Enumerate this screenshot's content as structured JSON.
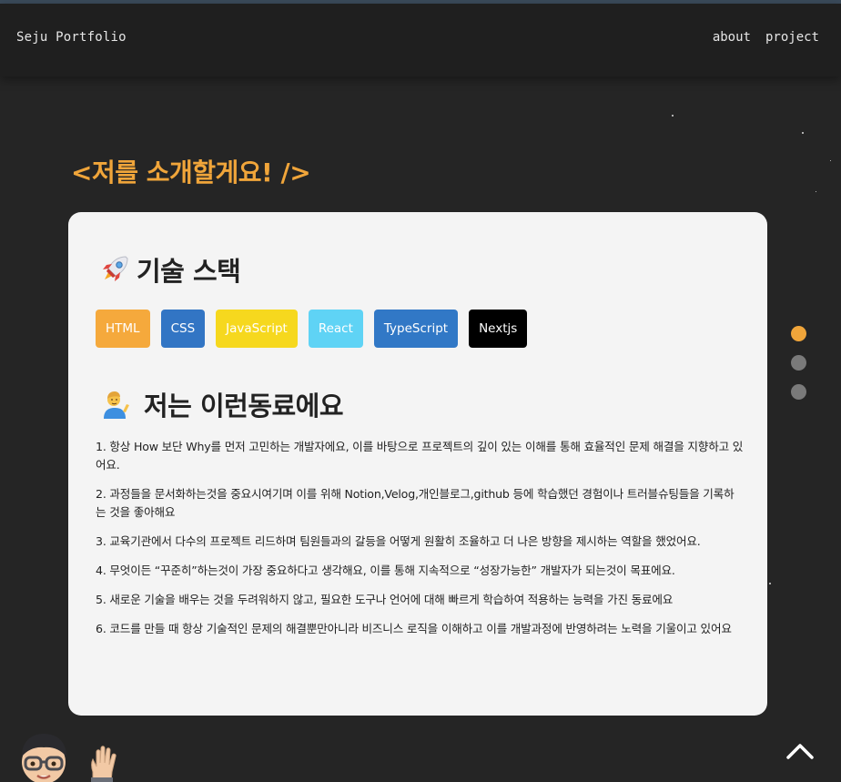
{
  "navbar": {
    "brand": "Seju Portfolio",
    "links": [
      {
        "label": "about"
      },
      {
        "label": "project"
      }
    ]
  },
  "section": {
    "title": "<저를 소개할게요! />"
  },
  "tech_stack": {
    "heading": "기술 스택",
    "heading_icon": "rocket-icon",
    "tags": [
      {
        "label": "HTML",
        "color": "#f5a93c"
      },
      {
        "label": "CSS",
        "color": "#3275c4"
      },
      {
        "label": "JavaScript",
        "color": "#f6d81e"
      },
      {
        "label": "React",
        "color": "#5fd3f5"
      },
      {
        "label": "TypeScript",
        "color": "#3178c6"
      },
      {
        "label": "Nextjs",
        "color": "#000000"
      }
    ]
  },
  "colleague": {
    "heading": "저는 이런동료에요",
    "heading_icon": "person-tipping-hand-icon",
    "items": [
      "1. 항상 How 보단 Why를 먼저 고민하는 개발자에요, 이를 바탕으로 프로젝트의 깊이 있는 이해를 통해 효율적인 문제 해결을 지향하고 있어요.",
      "2. 과정들을 문서화하는것을 중요시여기며 이를 위해 Notion,Velog,개인블로그,github 등에 학습했던 경험이나 트러블슈팅들을 기록하는 것을 좋아해요",
      "3. 교육기관에서 다수의 프로젝트 리드하며 팀원들과의 갈등을 어떻게 원활히 조율하고 더 나은 방향을 제시하는 역할을 했었어요.",
      "4. 무엇이든 “꾸준히”하는것이 가장 중요하다고 생각해요, 이를 통해 지속적으로 “성장가능한” 개발자가 되는것이 목표에요.",
      "5. 새로운 기술을 배우는 것을 두려워하지 않고, 필요한 도구나 언어에 대해 빠르게 학습하여 적용하는 능력을 가진 동료에요",
      "6. 코드를 만들 때 항상 기술적인 문제의 해결뿐만아니라 비즈니스 로직을 이해하고 이를 개발과정에 반영하려는 노력을 기울이고 있어요"
    ]
  },
  "pagination": {
    "active_index": 0,
    "count": 3,
    "active_color": "#f0a53a"
  },
  "footer": {
    "avatar_icon": "memoji-avatar-icon",
    "wave_icon": "waving-hand-icon",
    "scroll_top_icon": "chevron-up-icon"
  },
  "colors": {
    "background": "#252525",
    "navbar": "#1f1f1f",
    "accent": "#f0a53a",
    "card": "#f4f4f4"
  }
}
